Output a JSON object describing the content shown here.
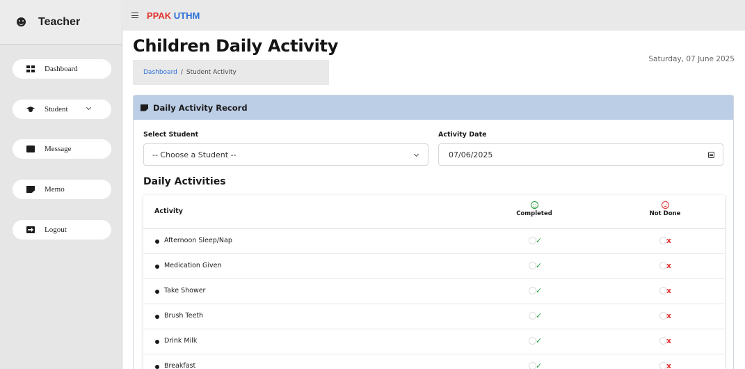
{
  "sidebar": {
    "brand": "Teacher",
    "items": [
      {
        "label": "Dashboard",
        "icon": "dashboard-icon"
      },
      {
        "label": "Student",
        "icon": "graduation-cap-icon"
      },
      {
        "label": "Message",
        "icon": "message-icon"
      },
      {
        "label": "Memo",
        "icon": "memo-icon"
      },
      {
        "label": "Logout",
        "icon": "logout-icon"
      }
    ]
  },
  "topbar": {
    "brand_part1": "PPAK",
    "brand_part2": "UTHM"
  },
  "header": {
    "title": "Children Daily Activity",
    "date": "Saturday, 07 June 2025",
    "breadcrumb": {
      "link": "Dashboard",
      "separator": "/",
      "current": "Student Activity"
    }
  },
  "card": {
    "title": "Daily Activity Record",
    "student_label": "Select Student",
    "student_value": "-- Choose a Student --",
    "date_label": "Activity Date",
    "date_value": "07/06/2025",
    "section_title": "Daily Activities"
  },
  "table": {
    "col_activity": "Activity",
    "col_completed": "Completed",
    "col_not_done": "Not Done",
    "check_mark": "✓",
    "x_mark": "x",
    "rows": [
      {
        "name": "Afternoon Sleep/Nap"
      },
      {
        "name": "Medication Given"
      },
      {
        "name": "Take Shower"
      },
      {
        "name": "Brush Teeth"
      },
      {
        "name": "Drink Milk"
      },
      {
        "name": "Breakfast"
      }
    ]
  },
  "colors": {
    "header_bg": "#bccde6",
    "brand_red": "#e0342f",
    "brand_blue": "#2b6fd6",
    "completed": "#22a03a",
    "not_done": "#e03232"
  }
}
